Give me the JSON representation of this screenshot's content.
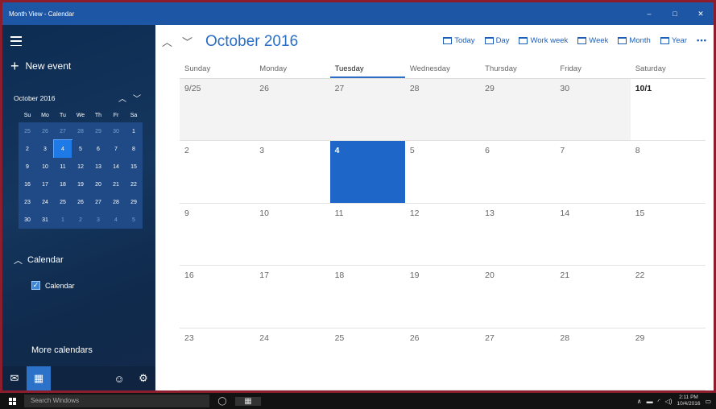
{
  "window": {
    "title": "Month View - Calendar",
    "controls": [
      "–",
      "□",
      "✕"
    ]
  },
  "sidebar": {
    "new_event_label": "New event",
    "mini_calendar": {
      "title": "October 2016",
      "days_of_week": [
        "Su",
        "Mo",
        "Tu",
        "We",
        "Th",
        "Fr",
        "Sa"
      ],
      "days": [
        {
          "d": "25",
          "other": true
        },
        {
          "d": "26",
          "other": true
        },
        {
          "d": "27",
          "other": true
        },
        {
          "d": "28",
          "other": true
        },
        {
          "d": "29",
          "other": true
        },
        {
          "d": "30",
          "other": true
        },
        {
          "d": "1"
        },
        {
          "d": "2"
        },
        {
          "d": "3"
        },
        {
          "d": "4",
          "today": true
        },
        {
          "d": "5"
        },
        {
          "d": "6"
        },
        {
          "d": "7"
        },
        {
          "d": "8"
        },
        {
          "d": "9"
        },
        {
          "d": "10"
        },
        {
          "d": "11"
        },
        {
          "d": "12"
        },
        {
          "d": "13"
        },
        {
          "d": "14"
        },
        {
          "d": "15"
        },
        {
          "d": "16"
        },
        {
          "d": "17"
        },
        {
          "d": "18"
        },
        {
          "d": "19"
        },
        {
          "d": "20"
        },
        {
          "d": "21"
        },
        {
          "d": "22"
        },
        {
          "d": "23"
        },
        {
          "d": "24"
        },
        {
          "d": "25"
        },
        {
          "d": "26"
        },
        {
          "d": "27"
        },
        {
          "d": "28"
        },
        {
          "d": "29"
        },
        {
          "d": "30"
        },
        {
          "d": "31"
        },
        {
          "d": "1",
          "other": true
        },
        {
          "d": "2",
          "other": true
        },
        {
          "d": "3",
          "other": true
        },
        {
          "d": "4",
          "other": true
        },
        {
          "d": "5",
          "other": true
        }
      ]
    },
    "calendar_section": "Calendar",
    "calendar_item": "Calendar",
    "more_calendars": "More calendars",
    "icons": [
      "mail-icon",
      "calendar-icon",
      "smiley-icon",
      "settings-icon"
    ]
  },
  "main": {
    "month_title": "October 2016",
    "views": [
      "Today",
      "Day",
      "Work week",
      "Week",
      "Month",
      "Year"
    ],
    "more": "•••",
    "days_of_week": [
      "Sunday",
      "Monday",
      "Tuesday",
      "Wednesday",
      "Thursday",
      "Friday",
      "Saturday"
    ],
    "selected_day_of_week": "Tuesday",
    "cells": [
      {
        "label": "9/25",
        "prev": true
      },
      {
        "label": "26",
        "prev": true
      },
      {
        "label": "27",
        "prev": true
      },
      {
        "label": "28",
        "prev": true
      },
      {
        "label": "29",
        "prev": true
      },
      {
        "label": "30",
        "prev": true
      },
      {
        "label": "10/1",
        "first": true
      },
      {
        "label": "2"
      },
      {
        "label": "3"
      },
      {
        "label": "4",
        "today": true
      },
      {
        "label": "5"
      },
      {
        "label": "6"
      },
      {
        "label": "7"
      },
      {
        "label": "8"
      },
      {
        "label": "9"
      },
      {
        "label": "10"
      },
      {
        "label": "11"
      },
      {
        "label": "12"
      },
      {
        "label": "13"
      },
      {
        "label": "14"
      },
      {
        "label": "15"
      },
      {
        "label": "16"
      },
      {
        "label": "17"
      },
      {
        "label": "18"
      },
      {
        "label": "19"
      },
      {
        "label": "20"
      },
      {
        "label": "21"
      },
      {
        "label": "22"
      },
      {
        "label": "23"
      },
      {
        "label": "24"
      },
      {
        "label": "25"
      },
      {
        "label": "26"
      },
      {
        "label": "27"
      },
      {
        "label": "28"
      },
      {
        "label": "29"
      }
    ]
  },
  "taskbar": {
    "search_placeholder": "Search Windows",
    "time": "2:11 PM",
    "date": "10/4/2016"
  }
}
